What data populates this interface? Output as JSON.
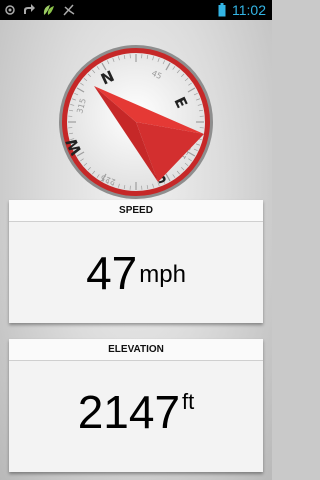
{
  "status_bar": {
    "time": "11:02",
    "icons": [
      "location-icon",
      "share-icon",
      "leaf-icon",
      "missed-call-icon",
      "battery-icon"
    ]
  },
  "compass": {
    "cardinals": {
      "north": "N",
      "east": "E",
      "south": "S",
      "west": "W"
    },
    "degree_labels": [
      "45",
      "135",
      "225",
      "315"
    ],
    "colors": {
      "rim": "#c62828",
      "needle": "#e53935",
      "needle_dark": "#b71c1c"
    }
  },
  "speed_card": {
    "title": "SPEED",
    "value": "47",
    "unit": "mph"
  },
  "elevation_card": {
    "title": "ELEVATION",
    "value": "2147",
    "unit": "ft"
  }
}
